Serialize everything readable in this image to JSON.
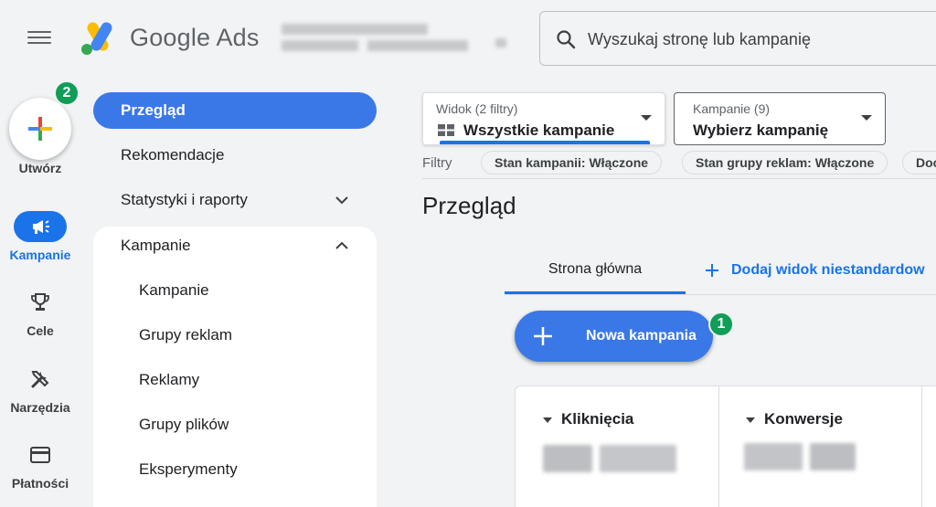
{
  "header": {
    "brand_name": "Google Ads",
    "search_placeholder": "Wyszukaj stronę lub kampanię"
  },
  "rail": {
    "create_label": "Utwórz",
    "create_badge": "2",
    "items": [
      {
        "label": "Kampanie",
        "icon": "megaphone-icon",
        "active": true
      },
      {
        "label": "Cele",
        "icon": "trophy-icon",
        "active": false
      },
      {
        "label": "Narzędzia",
        "icon": "tools-icon",
        "active": false
      },
      {
        "label": "Płatności",
        "icon": "credit-card-icon",
        "active": false
      }
    ]
  },
  "nav": {
    "items": [
      {
        "label": "Przegląd",
        "active": true
      },
      {
        "label": "Rekomendacje"
      },
      {
        "label": "Statystyki i raporty",
        "chevron": "down"
      },
      {
        "label": "Kampanie",
        "chevron": "up"
      },
      {
        "label": "Kampanie",
        "sub": true
      },
      {
        "label": "Grupy reklam",
        "sub": true
      },
      {
        "label": "Reklamy",
        "sub": true
      },
      {
        "label": "Grupy plików",
        "sub": true
      },
      {
        "label": "Eksperymenty",
        "sub": true
      }
    ]
  },
  "filters": {
    "view_small": "Widok (2 filtry)",
    "view_value": "Wszystkie kampanie",
    "campaign_small": "Kampanie (9)",
    "campaign_value": "Wybierz kampanię",
    "filters_label": "Filtry",
    "chips": [
      "Stan kampanii: Włączone",
      "Stan grupy reklam: Włączone",
      "Doc"
    ]
  },
  "main": {
    "page_title": "Przegląd",
    "tabs": {
      "home": "Strona główna",
      "add_custom": "Dodaj widok niestandardow"
    },
    "new_campaign_label": "Nowa kampania",
    "new_campaign_badge": "1",
    "metrics": [
      {
        "label": "Kliknięcia"
      },
      {
        "label": "Konwersje"
      }
    ]
  },
  "colors": {
    "accent": "#1a73e8",
    "button_blue": "#3b78e7",
    "badge_green": "#0f9d58"
  }
}
